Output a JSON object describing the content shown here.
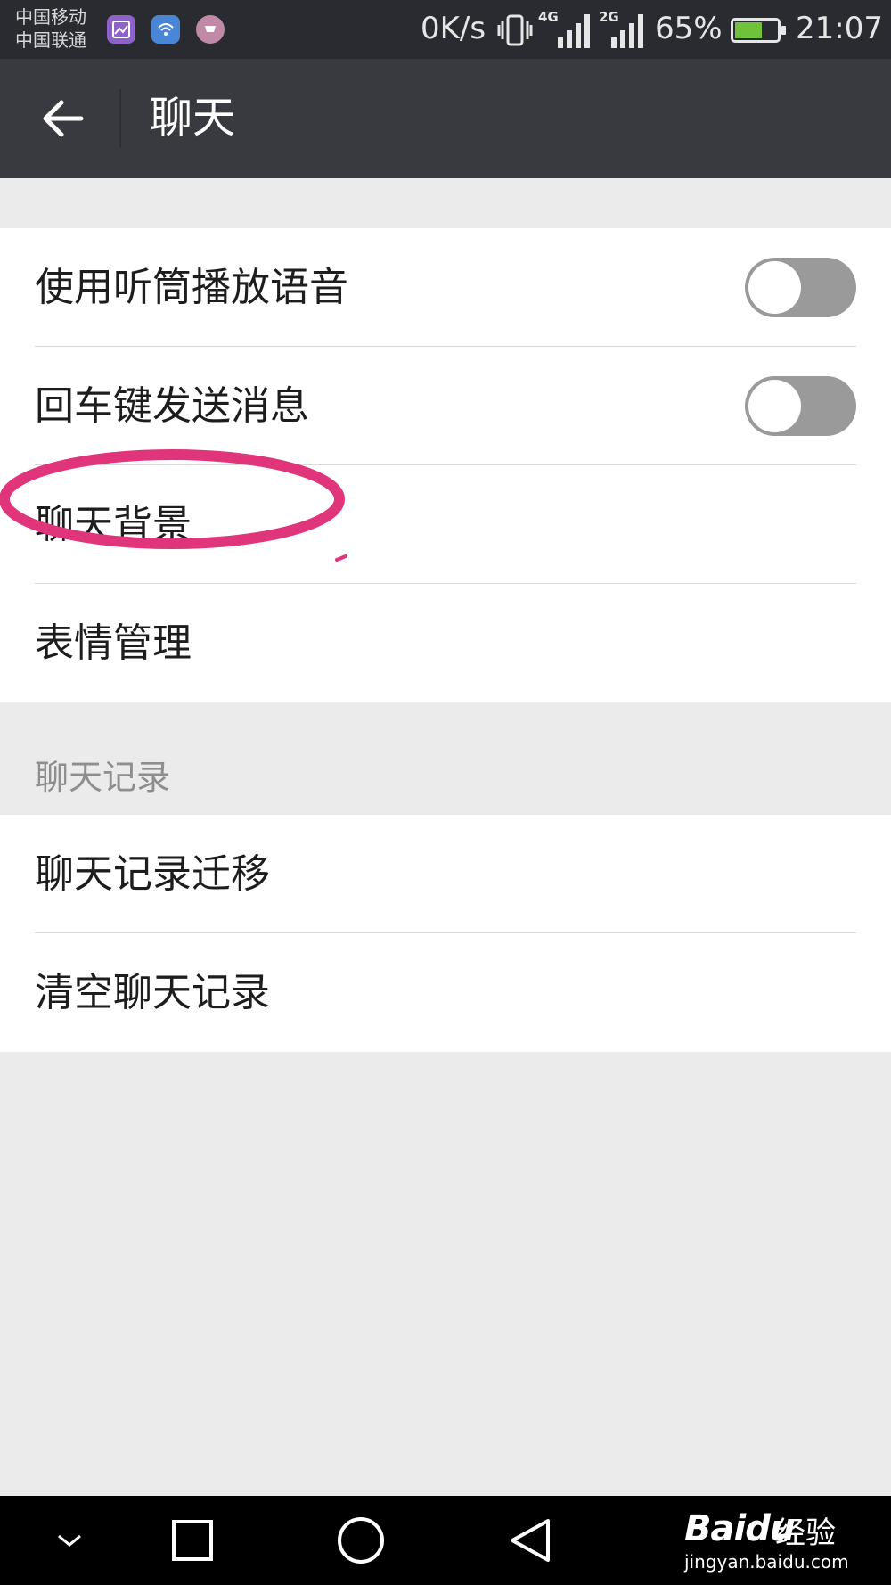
{
  "status_bar": {
    "carrier_1": "中国移动",
    "carrier_2": "中国联通",
    "net_speed": "0K/s",
    "signal_1_gen": "4G",
    "signal_2_gen": "2G",
    "battery_percent": "65%",
    "battery_level": 0.65,
    "time": "21:07",
    "icons": [
      "gallery-icon",
      "wifi-icon",
      "cart-icon",
      "vibrate-icon",
      "signal-icon",
      "battery-charging-icon"
    ]
  },
  "action_bar": {
    "title": "聊天",
    "back_icon": "arrow-left-icon"
  },
  "group1": {
    "items": [
      {
        "label": "使用听筒播放语音",
        "toggle": false
      },
      {
        "label": "回车键发送消息",
        "toggle": false
      },
      {
        "label": "聊天背景"
      },
      {
        "label": "表情管理"
      }
    ]
  },
  "section": {
    "header": "聊天记录"
  },
  "group2": {
    "items": [
      {
        "label": "聊天记录迁移"
      },
      {
        "label": "清空聊天记录"
      }
    ]
  },
  "nav_bar": {
    "icons": [
      "chevron-down-icon",
      "recent-apps-icon",
      "home-icon",
      "back-triangle-icon"
    ]
  },
  "watermark": {
    "brand": "Baidu",
    "sub": "经验",
    "url": "jingyan.baidu.com"
  },
  "colors": {
    "status_bar": "#2a2b30",
    "action_bar": "#393a3f",
    "background": "#ebebeb",
    "toggle_off": "#9a9a9a",
    "annotation": "#e0357a",
    "battery_fill": "#6fc23a"
  }
}
